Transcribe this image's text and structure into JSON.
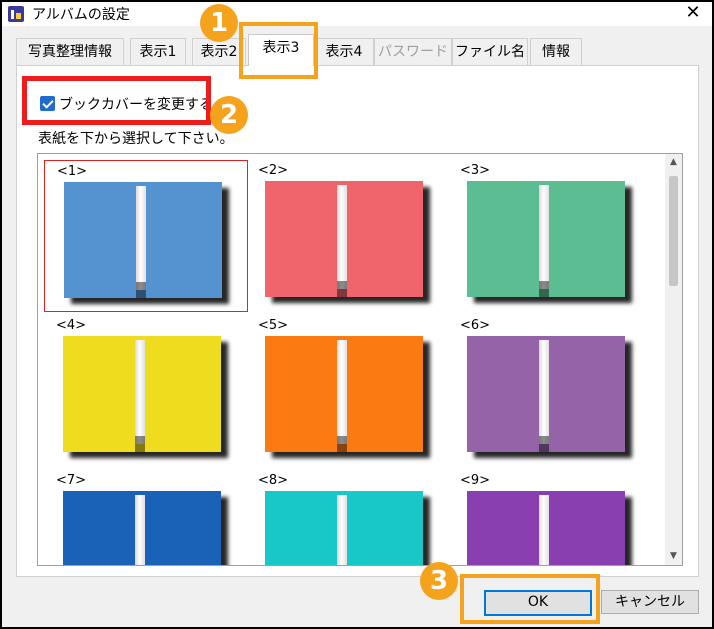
{
  "window": {
    "title": "アルバムの設定",
    "close_glyph": "✕"
  },
  "tabs": [
    {
      "label": "写真整理情報",
      "state": "normal"
    },
    {
      "label": "表示1",
      "state": "normal"
    },
    {
      "label": "表示2",
      "state": "normal"
    },
    {
      "label": "表示3",
      "state": "active"
    },
    {
      "label": "表示4",
      "state": "normal"
    },
    {
      "label": "パスワード",
      "state": "disabled"
    },
    {
      "label": "ファイル名",
      "state": "normal"
    },
    {
      "label": "情報",
      "state": "normal"
    }
  ],
  "options": {
    "change_cover_label": "ブックカバーを変更する",
    "change_cover_checked": true
  },
  "instruction": "表紙を下から選択して下さい。",
  "covers": [
    {
      "label": "<1>",
      "color": "#5592d0",
      "selected": true
    },
    {
      "label": "<2>",
      "color": "#f0646c",
      "selected": false
    },
    {
      "label": "<3>",
      "color": "#5cbd92",
      "selected": false
    },
    {
      "label": "<4>",
      "color": "#f0dc1e",
      "selected": false
    },
    {
      "label": "<5>",
      "color": "#fb7a12",
      "selected": false
    },
    {
      "label": "<6>",
      "color": "#9564a8",
      "selected": false
    },
    {
      "label": "<7>",
      "color": "#1a62b8",
      "selected": false
    },
    {
      "label": "<8>",
      "color": "#18c8c8",
      "selected": false
    },
    {
      "label": "<9>",
      "color": "#8a3fb0",
      "selected": false
    }
  ],
  "buttons": {
    "ok": "OK",
    "cancel": "キャンセル"
  },
  "annotations": {
    "step1": "1",
    "step2": "2",
    "step3": "3",
    "highlight_color": "#f5a31c",
    "checkbox_highlight_color": "#ee1c1c"
  }
}
